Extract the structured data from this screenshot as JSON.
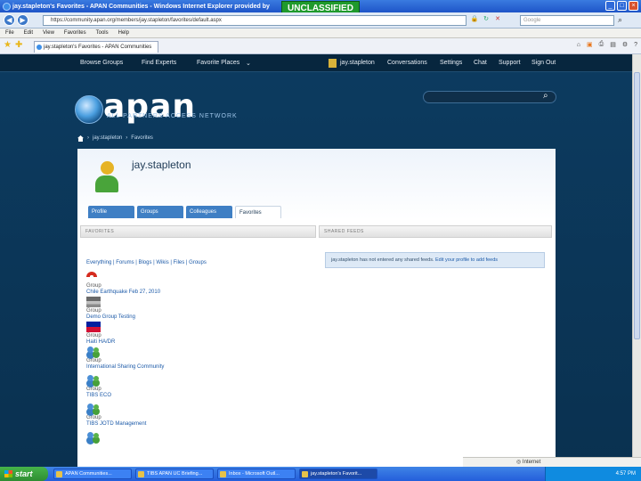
{
  "window": {
    "title": "jay.stapleton's Favorites - APAN Communities - Windows Internet Explorer provided by",
    "classification": "UNCLASSIFIED"
  },
  "addressbar": {
    "url": "https://community.apan.org/members/jay.stapleton/favorites/default.aspx",
    "search_placeholder": "Google"
  },
  "menubar": [
    "File",
    "Edit",
    "View",
    "Favorites",
    "Tools",
    "Help"
  ],
  "browser_tab": "jay.stapleton's Favorites - APAN Communities",
  "site": {
    "topnav": {
      "browse_groups": "Browse Groups",
      "find_experts": "Find Experts",
      "favorite_places": "Favorite Places",
      "user": "jay.stapleton",
      "conversations": "Conversations",
      "settings": "Settings",
      "chat": "Chat",
      "support": "Support",
      "sign_out": "Sign Out"
    },
    "logo": {
      "text": "apan",
      "subtitle": "ALL PARTNERS ACCESS NETWORK"
    },
    "breadcrumb": [
      "jay.stapleton",
      "Favorites"
    ],
    "profile": {
      "username": "jay.stapleton",
      "tabs": [
        "Profile",
        "Groups",
        "Colleagues",
        "Favorites"
      ],
      "active_tab": "Favorites"
    },
    "favorites_header": "FAVORITES",
    "shared_feeds_header": "SHARED FEEDS",
    "filters": "Everything | Forums | Blogs | Wikis | Files | Groups",
    "shared_feeds_message": "jay.stapleton has not entered any shared feeds.",
    "shared_feeds_link": "Edit your profile to add feeds",
    "favorites": [
      {
        "kind": "Group",
        "name": "Chile Earthquake Feb 27, 2010",
        "icon": "chile-flag"
      },
      {
        "kind": "Group",
        "name": "Demo Group Testing",
        "icon": "device"
      },
      {
        "kind": "Group",
        "name": "Haiti HA/DR",
        "icon": "haiti-flag"
      },
      {
        "kind": "Group",
        "name": "International Sharing Community",
        "icon": "people"
      },
      {
        "kind": "Group",
        "name": "TIBS ECO",
        "icon": "people"
      },
      {
        "kind": "Group",
        "name": "TIBS JOTD Management",
        "icon": "people"
      }
    ]
  },
  "statusbar": {
    "zone": "Internet"
  },
  "taskbar": {
    "start": "start",
    "items": [
      "APAN Communities...",
      "TIBS APAN UC Briefing...",
      "Inbox - Microsoft Outl...",
      "jay.stapleton's Favorit..."
    ],
    "clock": "4:57 PM"
  }
}
